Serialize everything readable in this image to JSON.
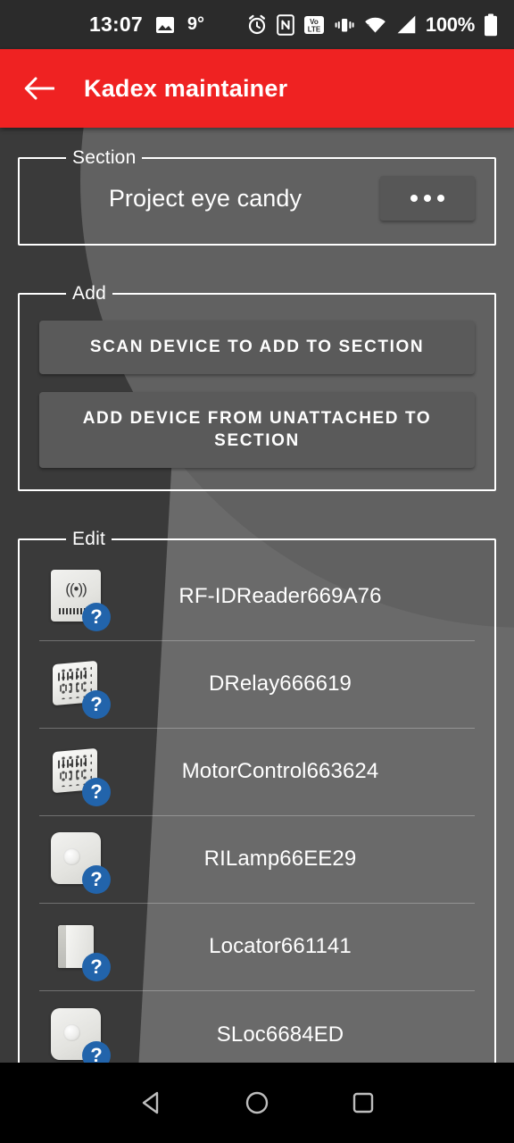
{
  "status_bar": {
    "clock": "13:07",
    "temperature": "9°",
    "battery_percent": "100%",
    "icons": [
      "photo-icon",
      "alarm-icon",
      "nfc-icon",
      "volte-icon",
      "vibrate-icon",
      "wifi-icon",
      "cell-signal-icon",
      "battery-icon"
    ]
  },
  "app_bar": {
    "back_label": "Back",
    "title": "Kadex maintainer"
  },
  "section": {
    "legend": "Section",
    "name": "Project eye candy",
    "menu_label": "More options"
  },
  "add": {
    "legend": "Add",
    "scan_label": "SCAN DEVICE TO ADD TO SECTION",
    "unattached_label": "ADD DEVICE FROM UNATTACHED TO SECTION"
  },
  "edit": {
    "legend": "Edit",
    "devices": [
      {
        "label": "RF-IDReader669A76",
        "icon": "rfid-reader-icon",
        "badge": "?"
      },
      {
        "label": "DRelay666619",
        "icon": "relay-module-icon",
        "badge": "?"
      },
      {
        "label": "MotorControl663624",
        "icon": "motor-control-icon",
        "badge": "?"
      },
      {
        "label": "RILamp66EE29",
        "icon": "lamp-switch-icon",
        "badge": "?"
      },
      {
        "label": "Locator661141",
        "icon": "locator-icon",
        "badge": "?"
      },
      {
        "label": "SLoc6684ED",
        "icon": "lamp-switch-icon",
        "badge": "?"
      }
    ]
  },
  "nav_bar": {
    "back": "back-triangle-icon",
    "home": "home-circle-icon",
    "recents": "recents-square-icon"
  },
  "colors": {
    "app_bar": "#ef2222",
    "badge": "#2264ab",
    "background_dark": "#3a3a3a",
    "background_light": "#6a6a6a",
    "status_bar": "#2b2b2b"
  }
}
